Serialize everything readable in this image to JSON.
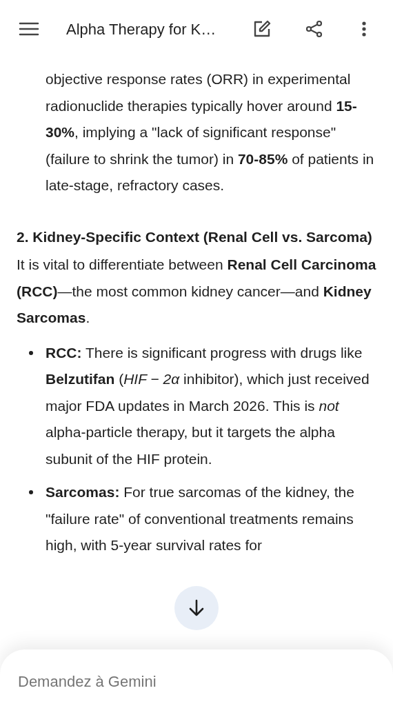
{
  "header": {
    "title": "Alpha Therapy for K…"
  },
  "continuation": "objective response rates (ORR) in experimental radionuclide therapies typically hover around **15-30%**, implying a \"lack of significant response\" (failure to shrink the tumor) in **70-85%** of patients in late-stage, refractory cases.",
  "section": {
    "heading": "2. Kidney-Specific Context (Renal Cell vs. Sarcoma)",
    "intro": "It is vital to differentiate between **Renal Cell Carcinoma (RCC)**—the most common kidney cancer—and **Kidney Sarcomas**.",
    "bullets": [
      {
        "text": "**RCC:** There is significant progress with drugs like **Belzutifan** (*HIF − 2α* inhibitor), which just received major FDA updates in March 2026. This is *not* alpha-particle therapy, but it targets the alpha subunit of the HIF protein."
      },
      {
        "text": "**Sarcomas:** For true sarcomas of the kidney, the \"failure rate\" of conventional treatments remains high, with 5-year survival rates for"
      }
    ]
  },
  "composer": {
    "placeholder": "Demandez à Gemini"
  }
}
